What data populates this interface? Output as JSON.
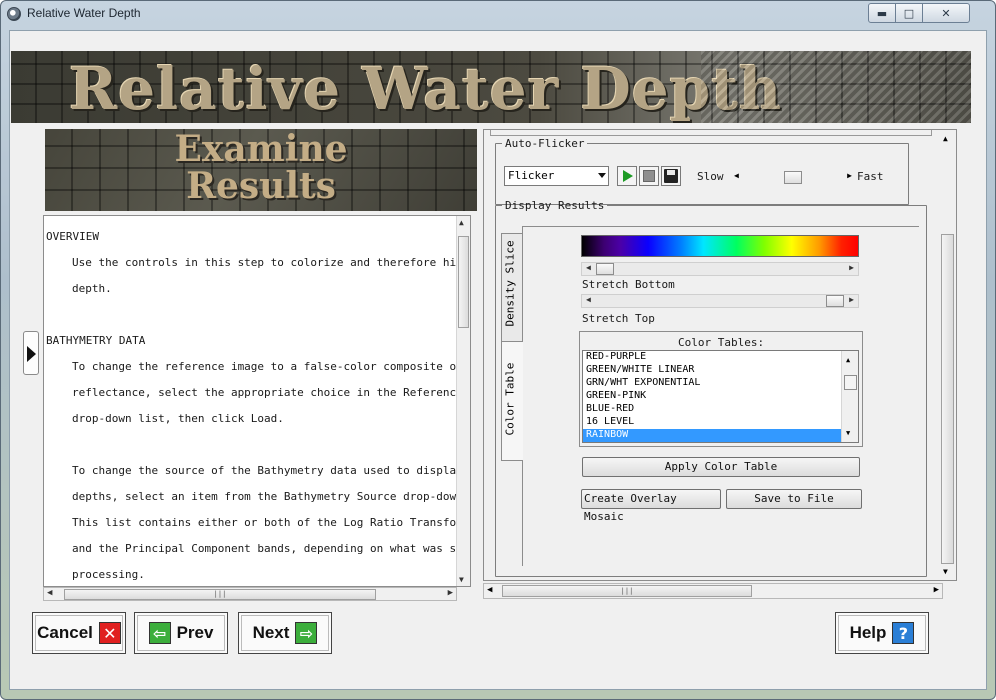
{
  "window": {
    "title": "Relative Water Depth",
    "controls": [
      "minimize",
      "maximize",
      "close"
    ]
  },
  "banner": {
    "title": "Relative Water Depth"
  },
  "step": {
    "title_line1": "Examine",
    "title_line2": "Results"
  },
  "help_text": {
    "overview_heading": "OVERVIEW",
    "overview_lines": [
      "Use the controls in this step to colorize and therefore hig",
      "depth."
    ],
    "bathymetry_heading": "BATHYMETRY DATA",
    "bathymetry_lines_1": [
      "To change the reference image to a false-color composite or",
      "reflectance, select the appropriate choice in the Reference",
      "drop-down list, then click Load."
    ],
    "bathymetry_lines_2": [
      "To change the source of the Bathymetry data used to display",
      "depths, select an item from the Bathymetry Source drop-down",
      "This list contains either or both of the Log Ratio Transfor",
      "and the Principal Component bands, depending on what was se",
      "processing."
    ]
  },
  "auto_flicker": {
    "group_label": "Auto-Flicker",
    "mode_value": "Flicker",
    "play_icon": "play-icon",
    "stop_icon": "stop-icon",
    "save_icon": "save-icon",
    "slow_label": "Slow",
    "fast_label": "Fast",
    "speed_level": 0.5
  },
  "display_results": {
    "group_label": "Display Results",
    "tabs": [
      "Density Slice",
      "Color Table"
    ],
    "active_tab": "Color Table",
    "stretch_bottom_label": "Stretch Bottom",
    "stretch_top_label": "Stretch Top",
    "stretch_bottom_level": 0.0,
    "stretch_top_level": 1.0,
    "color_tables_label": "Color Tables:",
    "color_tables": [
      "RED-PURPLE",
      "GREEN/WHITE LINEAR",
      "GRN/WHT EXPONENTIAL",
      "GREEN-PINK",
      "BLUE-RED",
      "16 LEVEL",
      "RAINBOW"
    ],
    "selected_color_table": "RAINBOW",
    "apply_button": "Apply Color Table",
    "overlay_button": "Create Overlay Mosaic",
    "save_button": "Save to File"
  },
  "nav": {
    "cancel": "Cancel",
    "prev": "Prev",
    "next": "Next",
    "help": "Help"
  },
  "colors": {
    "banner_text": "#b4a485",
    "selection": "#3399ff",
    "cancel_icon": "#e02020",
    "arrow_icon": "#3cae3c",
    "help_icon": "#2b7fd6"
  }
}
